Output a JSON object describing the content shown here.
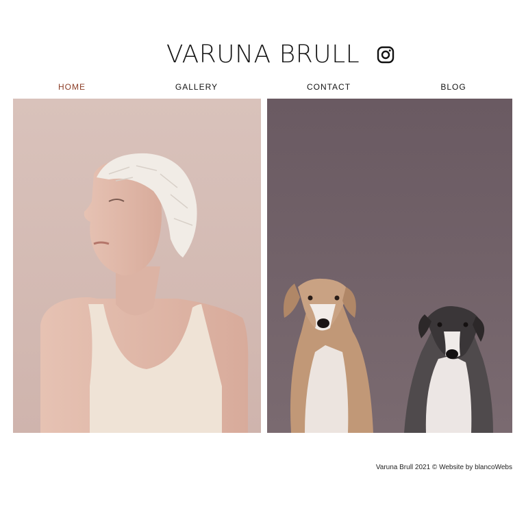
{
  "header": {
    "title": "VARUNA BRULL",
    "social_icon": "instagram-icon"
  },
  "nav": {
    "items": [
      {
        "label": "HOME",
        "active": true
      },
      {
        "label": "GALLERY",
        "active": false
      },
      {
        "label": "CONTACT",
        "active": false
      },
      {
        "label": "BLOG",
        "active": false
      }
    ],
    "active_color": "#8a3b24"
  },
  "gallery": {
    "photos": [
      {
        "subject": "woman-portrait",
        "background_color": "#d7bdb6"
      },
      {
        "subject": "two-dogs-portrait",
        "background_color": "#6e6067"
      }
    ]
  },
  "footer": {
    "text": "Varuna Brull 2021 © Website by blancoWebs"
  }
}
